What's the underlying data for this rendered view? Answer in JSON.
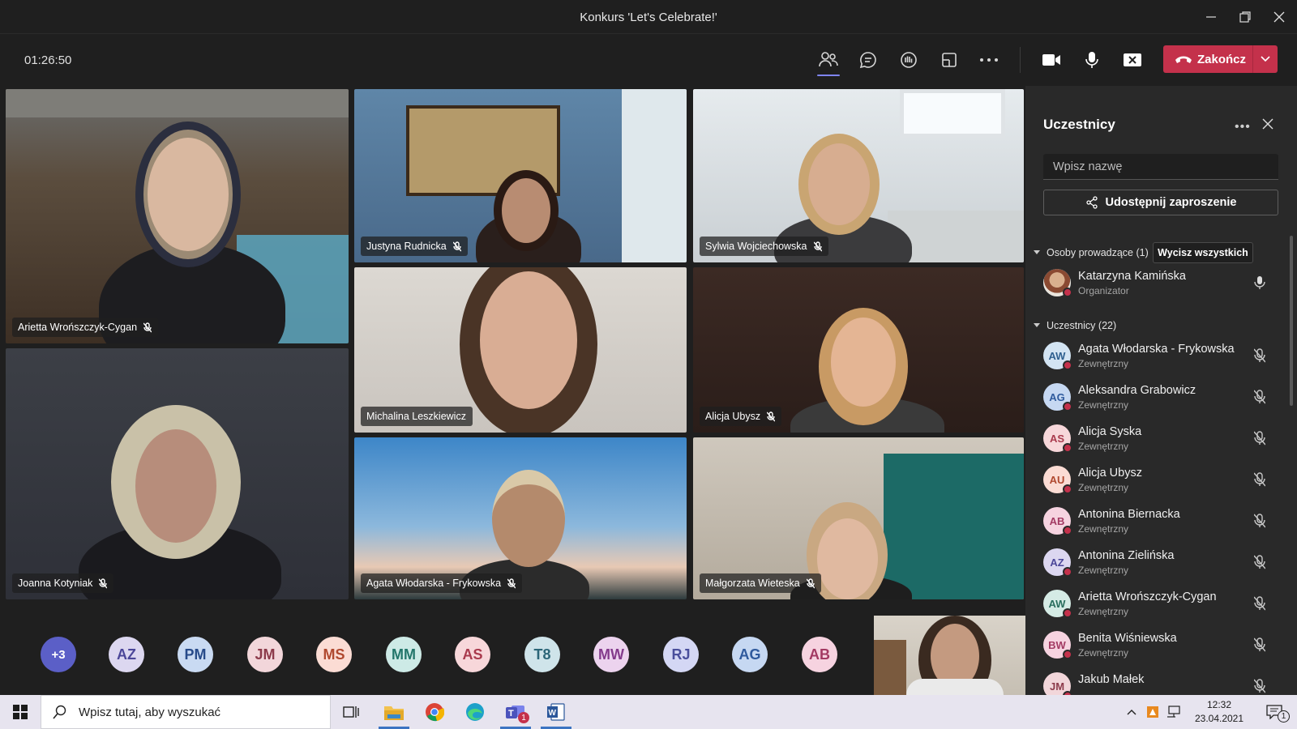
{
  "window": {
    "title": "Konkurs 'Let's Celebrate!'"
  },
  "toolbar": {
    "timer": "01:26:50",
    "end_label": "Zakończ"
  },
  "tiles": [
    {
      "name": "Arietta Wrońszczyk-Cygan"
    },
    {
      "name": "Justyna Rudnicka"
    },
    {
      "name": "Sylwia Wojciechowska"
    },
    {
      "name": "Joanna Kotyniak"
    },
    {
      "name": "Michalina Leszkiewicz"
    },
    {
      "name": "Alicja Ubysz"
    },
    {
      "name": "Agata Włodarska - Frykowska"
    },
    {
      "name": "Małgorzata Wieteska"
    }
  ],
  "strip": {
    "overflow": "+3",
    "avatars": [
      {
        "initials": "AZ",
        "bg": "#dcd7f0",
        "fg": "#4b4699"
      },
      {
        "initials": "PM",
        "bg": "#c9daf2",
        "fg": "#284b8a"
      },
      {
        "initials": "JM",
        "bg": "#f2d6da",
        "fg": "#8c3a4a"
      },
      {
        "initials": "MS",
        "bg": "#fbdcd4",
        "fg": "#b0492f"
      },
      {
        "initials": "MM",
        "bg": "#cdeae6",
        "fg": "#23766b"
      },
      {
        "initials": "AS",
        "bg": "#f7d7da",
        "fg": "#a93a4d"
      },
      {
        "initials": "T8",
        "bg": "#cfe4ea",
        "fg": "#2c6678"
      },
      {
        "initials": "MW",
        "bg": "#ecd3ee",
        "fg": "#843b8c"
      },
      {
        "initials": "RJ",
        "bg": "#d4d7f4",
        "fg": "#4a4f9c"
      },
      {
        "initials": "AG",
        "bg": "#c6d8f2",
        "fg": "#2f5a9d"
      },
      {
        "initials": "AB",
        "bg": "#f6d3e0",
        "fg": "#a33a63"
      }
    ]
  },
  "panel": {
    "title": "Uczestnicy",
    "search_placeholder": "Wpisz nazwę",
    "share_label": "Udostępnij zaproszenie",
    "presenters_header": "Osoby prowadzące (1)",
    "mute_all_label": "Wycisz wszystkich",
    "organizer": {
      "name": "Katarzyna Kamińska",
      "role": "Organizator"
    },
    "attendees_header": "Uczestnicy (22)",
    "attendees": [
      {
        "initials": "AW",
        "name": "Agata Włodarska - Frykowska",
        "role": "Zewnętrzny",
        "bg": "#d3e4f3",
        "fg": "#2e5f8f"
      },
      {
        "initials": "AG",
        "name": "Aleksandra Grabowicz",
        "role": "Zewnętrzny",
        "bg": "#c6d8f2",
        "fg": "#2f5a9d"
      },
      {
        "initials": "AS",
        "name": "Alicja Syska",
        "role": "Zewnętrzny",
        "bg": "#f7d7da",
        "fg": "#a93a4d"
      },
      {
        "initials": "AU",
        "name": "Alicja Ubysz",
        "role": "Zewnętrzny",
        "bg": "#fbdcd4",
        "fg": "#b0492f"
      },
      {
        "initials": "AB",
        "name": "Antonina Biernacka",
        "role": "Zewnętrzny",
        "bg": "#f6d3e0",
        "fg": "#a33a63"
      },
      {
        "initials": "AZ",
        "name": "Antonina Zielińska",
        "role": "Zewnętrzny",
        "bg": "#dcd7f0",
        "fg": "#4b4699"
      },
      {
        "initials": "AW",
        "name": "Arietta Wrońszczyk-Cygan",
        "role": "Zewnętrzny",
        "bg": "#d5ebe5",
        "fg": "#2a6e5e"
      },
      {
        "initials": "BW",
        "name": "Benita Wiśniewska",
        "role": "Zewnętrzny",
        "bg": "#f6d3e0",
        "fg": "#a33a63"
      },
      {
        "initials": "JM",
        "name": "Jakub Małek",
        "role": "",
        "bg": "#f2d6da",
        "fg": "#8c3a4a"
      }
    ]
  },
  "taskbar": {
    "search_placeholder": "Wpisz tutaj, aby wyszukać",
    "time": "12:32",
    "date": "23.04.2021",
    "notification_count": "1",
    "teams_badge": "1"
  }
}
